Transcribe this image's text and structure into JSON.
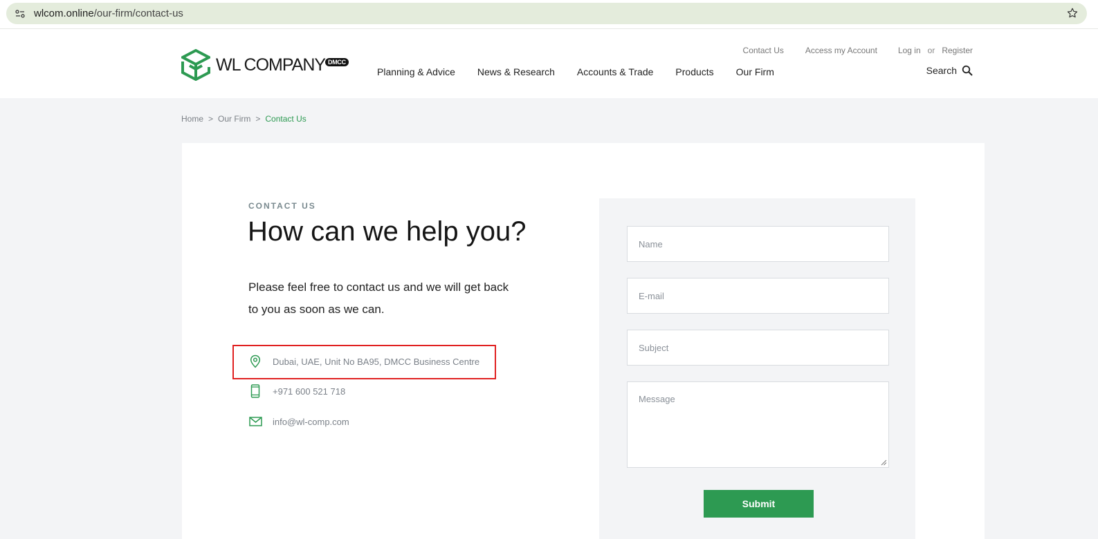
{
  "browser": {
    "url_host": "wlcom.online",
    "url_path": "/our-firm/contact-us"
  },
  "header": {
    "logo_text": "WL COMPANY",
    "logo_badge": "DMCC",
    "util_nav": {
      "contact": "Contact Us",
      "account": "Access my Account",
      "login": "Log in",
      "or": "or",
      "register": "Register"
    },
    "main_nav": [
      "Planning & Advice",
      "News & Research",
      "Accounts & Trade",
      "Products",
      "Our Firm"
    ],
    "search_label": "Search"
  },
  "breadcrumb": {
    "home": "Home",
    "sep": ">",
    "parent": "Our Firm",
    "current": "Contact Us"
  },
  "content": {
    "eyebrow": "CONTACT US",
    "headline": "How can we help you?",
    "lead": "Please feel free to contact us and we will get back to you as soon as we can.",
    "address": "Dubai, UAE, Unit No BA95, DMCC Business Centre",
    "phone": "+971 600 521 718",
    "email": "info@wl-comp.com"
  },
  "form": {
    "name_placeholder": "Name",
    "email_placeholder": "E-mail",
    "subject_placeholder": "Subject",
    "message_placeholder": "Message",
    "submit_label": "Submit"
  },
  "colors": {
    "brand_green": "#2d9a52",
    "highlight_red": "#e02020"
  }
}
